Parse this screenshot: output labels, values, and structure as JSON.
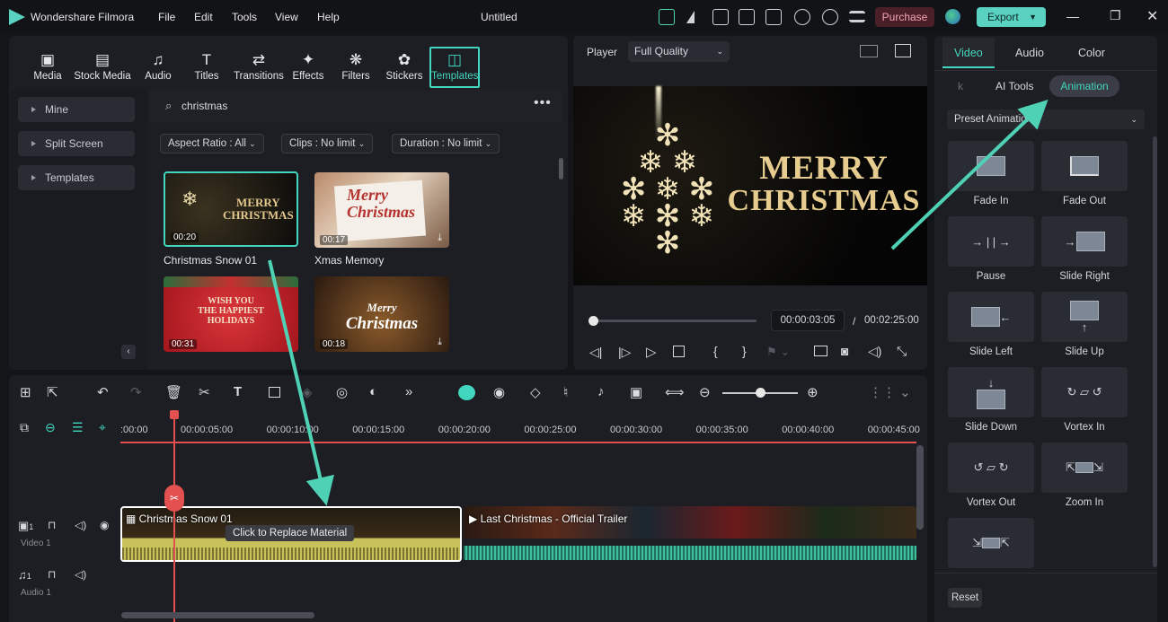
{
  "app": {
    "name": "Wondershare Filmora",
    "title": "Untitled",
    "purchase": "Purchase",
    "export": "Export"
  },
  "menu": [
    "File",
    "Edit",
    "Tools",
    "View",
    "Help"
  ],
  "toolbar": [
    {
      "label": "Media",
      "icon": "media-icon",
      "glyph": "▣"
    },
    {
      "label": "Stock Media",
      "icon": "stock-media-icon",
      "glyph": "▤"
    },
    {
      "label": "Audio",
      "icon": "audio-icon",
      "glyph": "♫"
    },
    {
      "label": "Titles",
      "icon": "titles-icon",
      "glyph": "T"
    },
    {
      "label": "Transitions",
      "icon": "transitions-icon",
      "glyph": "⇄"
    },
    {
      "label": "Effects",
      "icon": "effects-icon",
      "glyph": "✦"
    },
    {
      "label": "Filters",
      "icon": "filters-icon",
      "glyph": "❋"
    },
    {
      "label": "Stickers",
      "icon": "stickers-icon",
      "glyph": "✿"
    },
    {
      "label": "Templates",
      "icon": "templates-icon",
      "glyph": "◫"
    }
  ],
  "sidebar": [
    "Mine",
    "Split Screen",
    "Templates"
  ],
  "search": {
    "value": "christmas"
  },
  "filters": [
    "Aspect Ratio : All",
    "Clips : No limit",
    "Duration : No limit"
  ],
  "templates": [
    {
      "name": "Christmas Snow 01",
      "duration": "00:20",
      "art1": "MERRY",
      "art2": "CHRISTMAS"
    },
    {
      "name": "Xmas Memory",
      "duration": "00:17",
      "art1": "Merry",
      "art2": "Christmas"
    },
    {
      "name": "",
      "duration": "00:31",
      "art1": "WISH YOU",
      "art2": "THE HAPPIEST",
      "art3": "HOLIDAYS"
    },
    {
      "name": "",
      "duration": "00:18",
      "art1": "Merry",
      "art2": "Christmas"
    }
  ],
  "player": {
    "label": "Player",
    "quality": "Full Quality",
    "current": "00:00:03:05",
    "total": "00:02:25:00",
    "separator": "/",
    "line1": "MERRY",
    "line2": "CHRISTMAS",
    "progress": 0.02
  },
  "timeline": {
    "ticks": [
      ":00:00",
      "00:00:05:00",
      "00:00:10:00",
      "00:00:15:00",
      "00:00:20:00",
      "00:00:25:00",
      "00:00:30:00",
      "00:00:35:00",
      "00:00:40:00",
      "00:00:45:00"
    ],
    "tracks": [
      {
        "label": "Video 1",
        "num": "1"
      },
      {
        "label": "Audio 1",
        "num": "1"
      }
    ],
    "clip1": "Christmas Snow 01",
    "clip2": "Last Christmas - Official Trailer",
    "tooltip": "Click to Replace Material"
  },
  "right": {
    "tabs": [
      "Video",
      "Audio",
      "Color"
    ],
    "subtabs": [
      "k",
      "AI Tools",
      "Animation"
    ],
    "preset": "Preset Animation",
    "reset": "Reset",
    "animations": [
      {
        "name": "Fade In",
        "icon": "fade-in-icon"
      },
      {
        "name": "Fade Out",
        "icon": "fade-out-icon"
      },
      {
        "name": "Pause",
        "icon": "pause-icon"
      },
      {
        "name": "Slide Right",
        "icon": "slide-right-icon"
      },
      {
        "name": "Slide Left",
        "icon": "slide-left-icon"
      },
      {
        "name": "Slide Up",
        "icon": "slide-up-icon"
      },
      {
        "name": "Slide Down",
        "icon": "slide-down-icon"
      },
      {
        "name": "Vortex In",
        "icon": "vortex-in-icon"
      },
      {
        "name": "Vortex Out",
        "icon": "vortex-out-icon"
      },
      {
        "name": "Zoom In",
        "icon": "zoom-in-icon"
      },
      {
        "name": "",
        "icon": "zoom-out-icon"
      }
    ]
  },
  "colors": {
    "accent": "#42d6bf",
    "clip1": "#c9c25a",
    "clip2": "#3fbfa0",
    "playhead": "#e2514f"
  }
}
